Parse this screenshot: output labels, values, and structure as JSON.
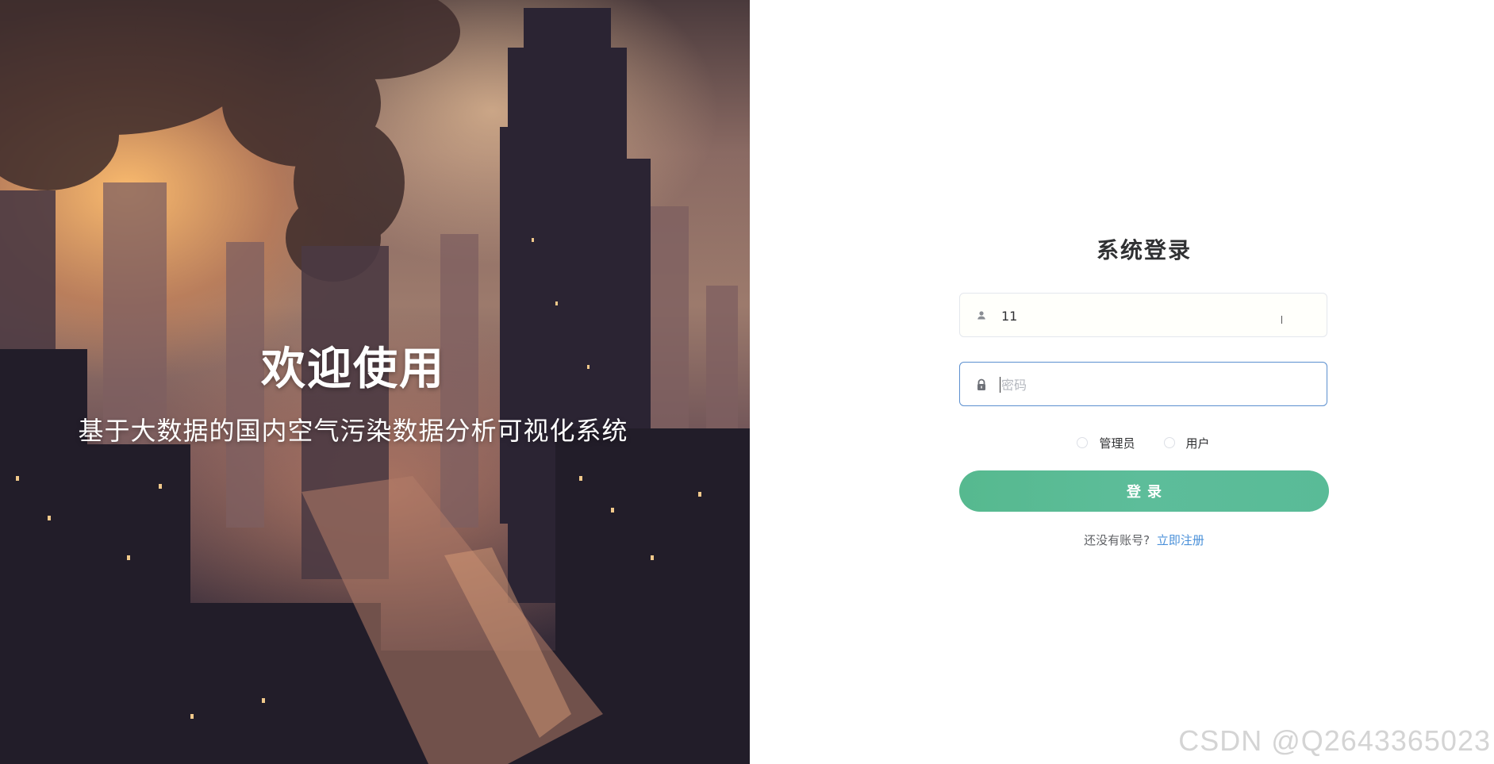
{
  "hero": {
    "title": "欢迎使用",
    "subtitle": "基于大数据的国内空气污染数据分析可视化系统"
  },
  "login": {
    "title": "系统登录",
    "username": {
      "value": "11",
      "icon": "user-icon"
    },
    "password": {
      "value": "",
      "placeholder": "密码",
      "icon": "lock-icon"
    },
    "roles": [
      {
        "label": "管理员",
        "selected": false
      },
      {
        "label": "用户",
        "selected": false
      }
    ],
    "submit_label": "登录",
    "register_prompt": "还没有账号?",
    "register_link": "立即注册",
    "accent_color": "#5abb96",
    "link_color": "#4a90d9"
  },
  "watermark": "CSDN @Q2643365023"
}
